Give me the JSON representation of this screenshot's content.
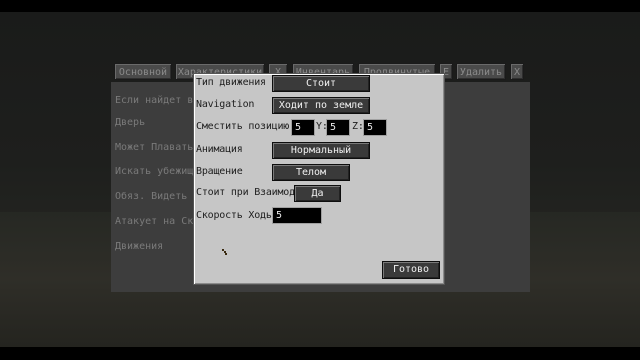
{
  "background": {
    "tabs": [
      {
        "label": "Основной"
      },
      {
        "label": "Характеристики"
      },
      {
        "label": "Х"
      },
      {
        "label": "Инвентарь"
      },
      {
        "label": "Продвинутые"
      },
      {
        "label": "Е"
      },
      {
        "label": "Удалить"
      },
      {
        "label": "Х"
      }
    ],
    "labels": [
      "Если найдет в",
      "Дверь",
      "Может Плавать",
      "Искать убежищ",
      "Обяз. Видеть ц",
      "Атакует на Ско",
      "Движения"
    ]
  },
  "dialog": {
    "movement_type_label": "Тип движения",
    "movement_type_value": "Стоит",
    "navigation_label": "Navigation",
    "navigation_value": "Ходит по земле",
    "offset_label": "Сместить позицию",
    "offset_x": "5",
    "offset_y_label": "Y:",
    "offset_y": "5",
    "offset_z_label": "Z:",
    "offset_z": "5",
    "animation_label": "Анимация",
    "animation_value": "Нормальный",
    "rotation_label": "Вращение",
    "rotation_value": "Телом",
    "interact_label": "Стоит при Взаимодействии",
    "interact_value": "Да",
    "walk_speed_label": "Скорость Ходьбы",
    "walk_speed_value": "5",
    "done_label": "Готово"
  }
}
